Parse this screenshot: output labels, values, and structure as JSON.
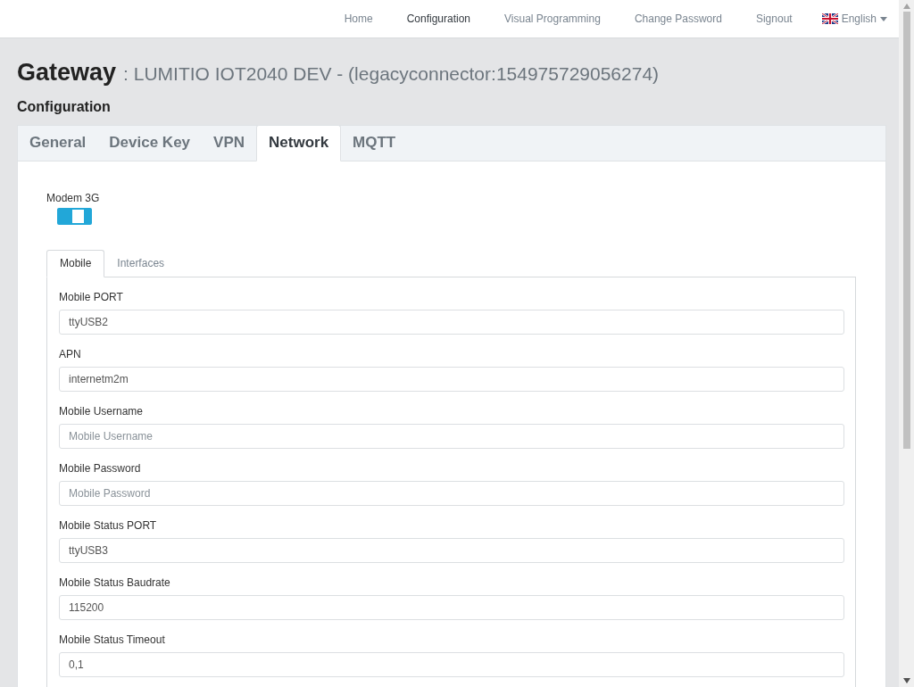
{
  "nav": {
    "items": [
      {
        "label": "Home",
        "selected": false
      },
      {
        "label": "Configuration",
        "selected": true
      },
      {
        "label": "Visual Programming",
        "selected": false
      },
      {
        "label": "Change Password",
        "selected": false
      },
      {
        "label": "Signout",
        "selected": false
      }
    ],
    "language": "English"
  },
  "header": {
    "title": "Gateway",
    "subtitle": ": LUMITIO IOT2040 DEV - (legacyconnector:154975729056274)",
    "section": "Configuration"
  },
  "tabs": [
    {
      "label": "General",
      "selected": false
    },
    {
      "label": "Device Key",
      "selected": false
    },
    {
      "label": "VPN",
      "selected": false
    },
    {
      "label": "Network",
      "selected": true
    },
    {
      "label": "MQTT",
      "selected": false
    }
  ],
  "modem": {
    "label": "Modem 3G",
    "on": true
  },
  "subtabs": [
    {
      "label": "Mobile",
      "selected": true
    },
    {
      "label": "Interfaces",
      "selected": false
    }
  ],
  "fields": [
    {
      "label": "Mobile PORT",
      "value": "ttyUSB2"
    },
    {
      "label": "APN",
      "value": "internetm2m"
    },
    {
      "label": "Mobile Username",
      "placeholder": "Mobile Username"
    },
    {
      "label": "Mobile Password",
      "placeholder": "Mobile Password"
    },
    {
      "label": "Mobile Status PORT",
      "value": "ttyUSB3"
    },
    {
      "label": "Mobile Status Baudrate",
      "value": "115200"
    },
    {
      "label": "Mobile Status Timeout",
      "value": "0,1"
    }
  ]
}
